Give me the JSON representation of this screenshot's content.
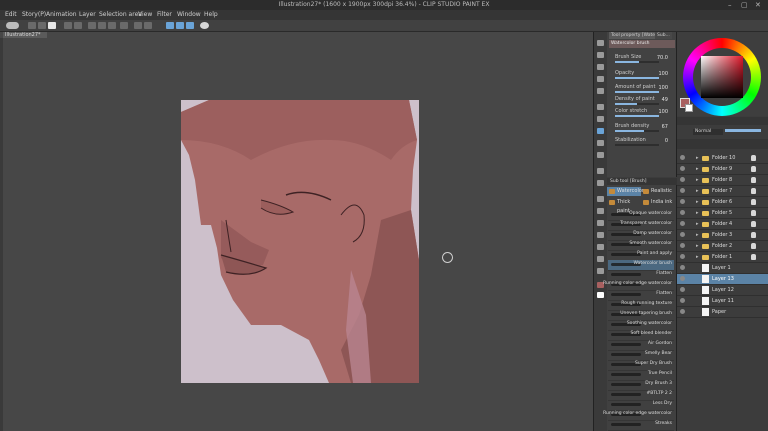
{
  "window": {
    "title": "Illustration27* (1600 x 1900px 300dpi 36.4%) - CLIP STUDIO PAINT EX"
  },
  "menu": [
    "Edit",
    "Story(P)",
    "Animation",
    "Layer",
    "Selection area",
    "View",
    "Filter",
    "Window",
    "Help"
  ],
  "document": {
    "tab_label": "Illustration27*"
  },
  "artwork": {
    "colors": {
      "face": "#a86a68",
      "shadow": "#8e5655",
      "background": "#cdc0cb",
      "line": "#3e2224"
    }
  },
  "tool_property": {
    "tabs": [
      "Tool property [Waterc...",
      "Sub..."
    ],
    "brush_name": "Watercolor brush",
    "rows": [
      {
        "label": "Brush Size",
        "value": "70.0",
        "fill": 0.55
      },
      {
        "label": "Opacity",
        "value": "100",
        "fill": 1.0
      },
      {
        "label": "Amount of paint",
        "value": "100",
        "fill": 1.0
      },
      {
        "label": "Density of paint",
        "value": "49",
        "fill": 0.49
      },
      {
        "label": "Color stretch",
        "value": "100",
        "fill": 1.0
      },
      {
        "label": "Brush density",
        "value": "67",
        "fill": 0.67
      },
      {
        "label": "Stabilization",
        "value": "0",
        "fill": 0.0
      }
    ]
  },
  "sub_tool": {
    "header": "Sub tool [Brush]",
    "groups": [
      "Watercolor",
      "Realistic",
      "Thick paint",
      "India ink"
    ],
    "brushes": [
      "Opaque watercolor",
      "Transparent watercolor",
      "Damp watercolor",
      "Smooth watercolor",
      "Paint and apply",
      "Watercolor brush",
      "Flatten",
      "Running color edge watercolor",
      "Flatten",
      "Rough running texture",
      "Uneven tapering brush",
      "Soothing watercolor",
      "Soft bleed blender",
      "Air Gordon",
      "Smelly Bear",
      "Super Dry Brush",
      "True Pencil",
      "Dry Brush 3",
      "#BTLTP 2 2",
      "Less Dry",
      "Running color edge watercolor",
      "Streaks"
    ],
    "selected_brush": 5
  },
  "layers": {
    "blend_mode": "Normal",
    "opacity": "100",
    "items": [
      {
        "name": "Folder 10",
        "kind": "folder",
        "visible": true
      },
      {
        "name": "Folder 9",
        "kind": "folder",
        "visible": true
      },
      {
        "name": "Folder 8",
        "kind": "folder",
        "visible": true
      },
      {
        "name": "Folder 7",
        "kind": "folder",
        "visible": true
      },
      {
        "name": "Folder 6",
        "kind": "folder",
        "visible": true
      },
      {
        "name": "Folder 5",
        "kind": "folder",
        "visible": true
      },
      {
        "name": "Folder 4",
        "kind": "folder",
        "visible": true
      },
      {
        "name": "Folder 3",
        "kind": "folder",
        "visible": true
      },
      {
        "name": "Folder 2",
        "kind": "folder",
        "visible": true
      },
      {
        "name": "Folder 1",
        "kind": "folder",
        "visible": true
      },
      {
        "name": "Layer 1",
        "kind": "layer",
        "visible": true
      },
      {
        "name": "Layer 13",
        "kind": "layer",
        "visible": true,
        "selected": true
      },
      {
        "name": "Layer 12",
        "kind": "layer",
        "visible": true
      },
      {
        "name": "Layer 11",
        "kind": "layer",
        "visible": true
      },
      {
        "name": "Paper",
        "kind": "paper",
        "visible": true
      }
    ]
  }
}
